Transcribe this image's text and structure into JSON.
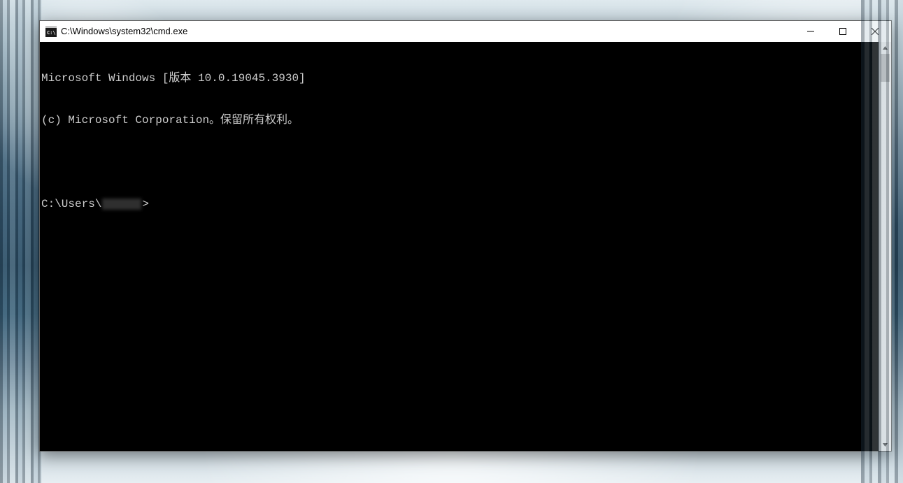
{
  "window": {
    "title": "C:\\Windows\\system32\\cmd.exe"
  },
  "console": {
    "line1": "Microsoft Windows [版本 10.0.19045.3930]",
    "line2": "(c) Microsoft Corporation。保留所有权利。",
    "prompt_prefix": "C:\\Users\\",
    "prompt_suffix": ">"
  }
}
